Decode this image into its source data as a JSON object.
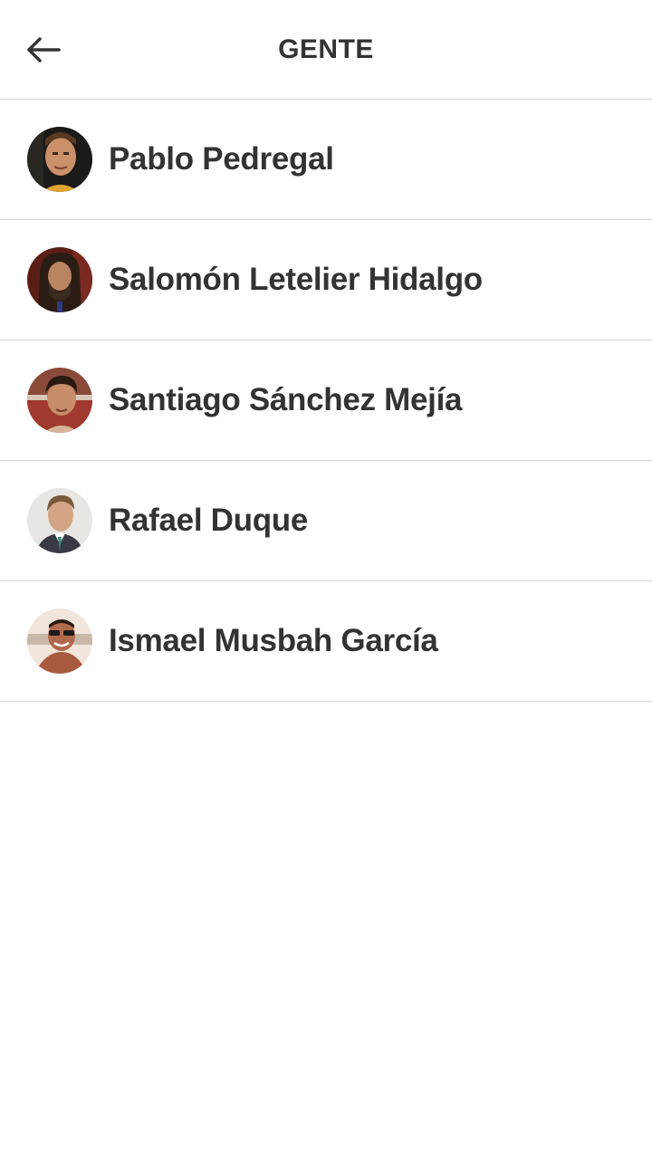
{
  "header": {
    "title": "GENTE",
    "back_icon": "arrow-left-icon"
  },
  "people": [
    {
      "name": "Pablo Pedregal"
    },
    {
      "name": "Salomón Letelier Hidalgo"
    },
    {
      "name": "Santiago Sánchez Mejía"
    },
    {
      "name": "Rafael Duque"
    },
    {
      "name": "Ismael Musbah García"
    }
  ],
  "colors": {
    "text": "#333333",
    "divider": "#d2d2d2",
    "background": "#ffffff"
  }
}
